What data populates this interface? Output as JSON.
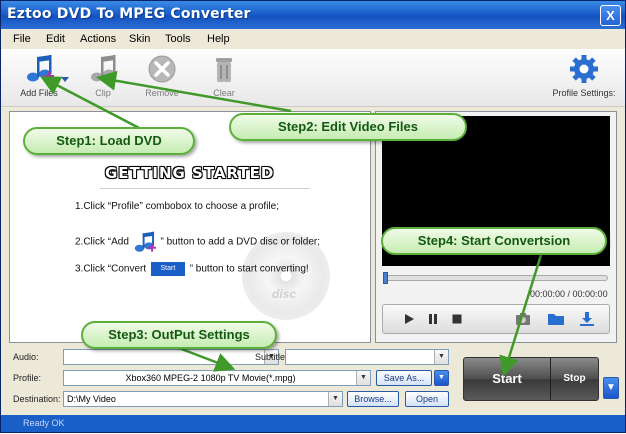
{
  "window": {
    "title": "Eztoo DVD To MPEG Converter",
    "close_label": "X"
  },
  "menu": [
    "File",
    "Edit",
    "Actions",
    "Skin",
    "Tools",
    "Help"
  ],
  "toolbar": {
    "add_files": "Add Files",
    "clip": "Clip",
    "remove": "Remove",
    "clear": "Clear",
    "profile_settings": "Profile Settings:"
  },
  "getting_started": {
    "title": "GETTING STARTED",
    "step1": "1.Click “Profile” combobox to choose a profile;",
    "step2_a": "2.Click “Add",
    "step2_b": "” button to add a DVD disc or folder;",
    "step3_a": "3.Click “Convert",
    "step3_b": "” button to start converting!",
    "start_icon_label": "Start",
    "disc_label": "disc"
  },
  "player": {
    "time": "00:00:00 / 00:00:00",
    "progress": 0
  },
  "settings": {
    "audio_label": "Audio:",
    "subtitle_label": "Subtitle:",
    "profile_label": "Profile:",
    "profile_value": "Xbox360 MPEG-2 1080p TV Movie(*.mpg)",
    "save_as": "Save As...",
    "destination_label": "Destination:",
    "destination_value": "D:\\My Video",
    "browse": "Browse...",
    "open": "Open"
  },
  "actions": {
    "start": "Start",
    "stop": "Stop"
  },
  "status": {
    "text": "Ready OK"
  },
  "callouts": {
    "step1": "Step1: Load DVD",
    "step2": "Step2: Edit Video Files",
    "step3": "Step3: OutPut Settings",
    "step4": "Step4: Start Convertsion"
  },
  "colors": {
    "title_bar": "#1a5fcb",
    "callout_border": "#5ab03a",
    "callout_text": "#145a10",
    "arrow": "#3f9a2a"
  }
}
